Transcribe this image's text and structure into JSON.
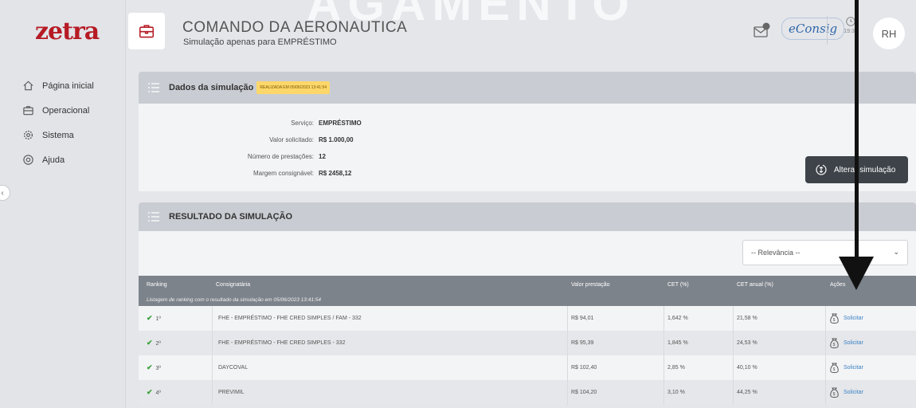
{
  "app": {
    "logo": "zetra"
  },
  "watermark": "AGAMENTO",
  "sidebar": {
    "items": [
      {
        "label": "Página inicial",
        "icon": "home-icon"
      },
      {
        "label": "Operacional",
        "icon": "briefcase-icon"
      },
      {
        "label": "Sistema",
        "icon": "gear-icon"
      },
      {
        "label": "Ajuda",
        "icon": "help-icon"
      }
    ]
  },
  "header": {
    "title": "COMANDO DA AERONAUTICA",
    "subtitle": "Simulação apenas para EMPRÉSTIMO",
    "econsig": "eConsig",
    "clock_time": "19:34",
    "avatar": "RH"
  },
  "simulation": {
    "title": "Dados da simulação",
    "badge": "REALIZADA EM 05/06/2023 13:41:54",
    "fields": [
      {
        "label": "Serviço:",
        "value": "EMPRÉSTIMO"
      },
      {
        "label": "Valor solicitado:",
        "value": "R$ 1.000,00"
      },
      {
        "label": "Número de prestações:",
        "value": "12"
      },
      {
        "label": "Margem consignável:",
        "value": "R$ 2458,12"
      }
    ],
    "alter_button": "Alterar simulação"
  },
  "result": {
    "title": "RESULTADO DA SIMULAÇÃO",
    "sort_select": "-- Relevância --",
    "columns": {
      "ranking": "Ranking",
      "consignataria": "Consignatária",
      "valor": "Valor prestação",
      "cet": "CET (%)",
      "cet_anual": "CET anual (%)",
      "acoes": "Ações"
    },
    "caption": "Listagem de ranking com o resultado da simulação em 05/06/2023 13:41:54",
    "action_label": "Solicitar",
    "rows": [
      {
        "rank": "1º",
        "consignataria": "FHE - EMPRÉSTIMO - FHE CRED SIMPLES / FAM - 332",
        "valor": "R$ 94,01",
        "cet": "1,642 %",
        "cet_anual": "21,58 %"
      },
      {
        "rank": "2º",
        "consignataria": "FHE - EMPRÉSTIMO - FHE CRED SIMPLES - 332",
        "valor": "R$ 95,39",
        "cet": "1,845 %",
        "cet_anual": "24,53 %"
      },
      {
        "rank": "3º",
        "consignataria": "DAYCOVAL",
        "valor": "R$ 102,40",
        "cet": "2,85 %",
        "cet_anual": "40,10 %"
      },
      {
        "rank": "4º",
        "consignataria": "PREVIMIL",
        "valor": "R$ 104,20",
        "cet": "3,10 %",
        "cet_anual": "44,25 %"
      }
    ]
  }
}
